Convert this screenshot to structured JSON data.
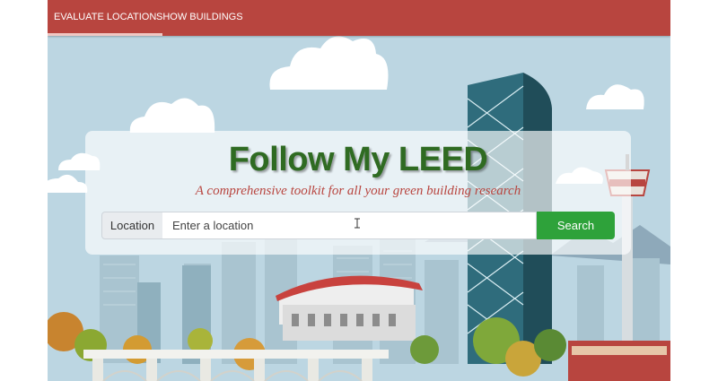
{
  "navbar": {
    "tabs": [
      {
        "label": "EVALUATE LOCATION",
        "active": true
      },
      {
        "label": "SHOW BUILDINGS",
        "active": false
      }
    ],
    "color": "#b8453f"
  },
  "hero": {
    "title": "Follow My LEED",
    "subtitle": "A comprehensive toolkit for all your green building research",
    "title_color": "#2f6b22",
    "subtitle_color": "#b8453f"
  },
  "search": {
    "label": "Location",
    "placeholder": "Enter a location",
    "value": "",
    "button_label": "Search",
    "button_color": "#2ea23a"
  },
  "icons": {
    "pointer": "text-cursor-icon"
  }
}
